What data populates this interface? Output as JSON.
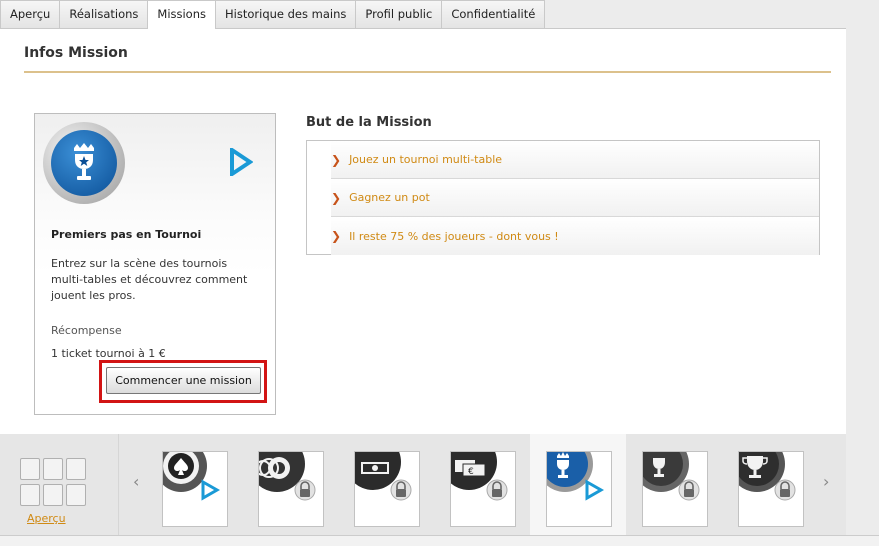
{
  "tabs": [
    {
      "label": "Aperçu"
    },
    {
      "label": "Réalisations"
    },
    {
      "label": "Missions",
      "active": true
    },
    {
      "label": "Historique des mains"
    },
    {
      "label": "Profil public"
    },
    {
      "label": "Confidentialité"
    }
  ],
  "panel": {
    "title": "Infos Mission"
  },
  "mission": {
    "icon": "trophy-star-icon",
    "name": "Premiers pas en Tournoi",
    "description": "Entrez sur la scène des tournois multi-tables et découvrez comment jouent les pros.",
    "reward_label": "Récompense",
    "reward_value": "1 ticket tournoi à 1 €",
    "start_button": "Commencer une mission"
  },
  "goal": {
    "title": "But de la Mission",
    "items": [
      {
        "text": "Jouez un tournoi multi-table"
      },
      {
        "text": "Gagnez un pot"
      },
      {
        "text": "Il reste 75 % des joueurs - dont vous !"
      }
    ]
  },
  "strip": {
    "overview_label": "Aperçu",
    "thumbnails": [
      {
        "icon": "spade-chip-icon",
        "status": "play"
      },
      {
        "icon": "chips-stack-icon",
        "status": "locked"
      },
      {
        "icon": "cash-icon",
        "status": "locked"
      },
      {
        "icon": "euro-bills-icon",
        "status": "locked"
      },
      {
        "icon": "trophy-star-icon",
        "status": "play",
        "active": true
      },
      {
        "icon": "trophy-icon",
        "status": "locked"
      },
      {
        "icon": "trophy-large-icon",
        "status": "locked"
      }
    ]
  },
  "colors": {
    "accent": "#d08a14",
    "highlight": "#d21414",
    "play_blue": "#1a9ad6",
    "rule": "#dcc18c"
  }
}
